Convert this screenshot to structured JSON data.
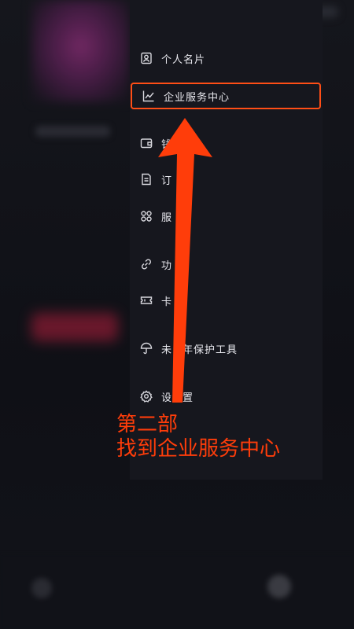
{
  "drawer": {
    "items": [
      {
        "label": "个人名片",
        "icon": "id-card-icon"
      },
      {
        "label": "企业服务中心",
        "icon": "chart-line-icon"
      },
      {
        "label": "钱",
        "icon": "wallet-icon"
      },
      {
        "label": "订",
        "icon": "order-icon"
      },
      {
        "label": "服",
        "icon": "grid-icon"
      },
      {
        "label": "功",
        "icon": "link-icon"
      },
      {
        "label": "卡",
        "icon": "ticket-icon"
      },
      {
        "label": "未",
        "label_tail": "年保护工具",
        "icon": "umbrella-icon"
      },
      {
        "label": "设",
        "label_tail": "置",
        "icon": "gear-icon"
      }
    ]
  },
  "annotation": {
    "line1": "第二部",
    "line2": "找到企业服务中心",
    "color": "#ff3d0a"
  },
  "highlight_color": "#ff4e16"
}
